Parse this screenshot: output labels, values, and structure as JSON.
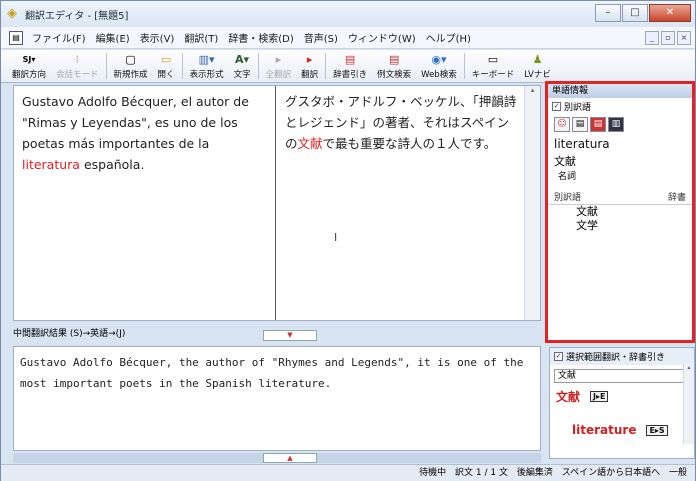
{
  "window": {
    "title": "翻訳エディタ - [無題5]",
    "controls": {
      "minimize": "–",
      "maximize": "□",
      "close": "✕"
    }
  },
  "menu": {
    "items": [
      "ファイル(F)",
      "編集(E)",
      "表示(V)",
      "翻訳(T)",
      "辞書・検索(D)",
      "音声(S)",
      "ウィンドウ(W)",
      "ヘルプ(H)"
    ]
  },
  "toolbar": {
    "buttons": [
      {
        "label": "翻訳方向",
        "icon": "SJ▾",
        "enabled": true
      },
      {
        "label": "会話モード",
        "icon": "⁞",
        "enabled": false
      },
      {
        "label": "新規作成",
        "icon": "▢",
        "enabled": true
      },
      {
        "label": "開く",
        "icon": "▭",
        "enabled": true
      },
      {
        "label": "表示形式",
        "icon": "▥▾",
        "enabled": true
      },
      {
        "label": "文字",
        "icon": "A▾",
        "enabled": true
      },
      {
        "label": "全翻訳",
        "icon": "▸",
        "enabled": false
      },
      {
        "label": "翻訳",
        "icon": "▸",
        "enabled": true
      },
      {
        "label": "辞書引き",
        "icon": "▤",
        "enabled": true
      },
      {
        "label": "例文検索",
        "icon": "▤",
        "enabled": true
      },
      {
        "label": "Web検索",
        "icon": "◉▾",
        "enabled": true
      },
      {
        "label": "キーボード",
        "icon": "▭",
        "enabled": true
      },
      {
        "label": "LVナビ",
        "icon": "♟",
        "enabled": true
      }
    ]
  },
  "editor": {
    "source_pre": "Gustavo Adolfo Bécquer, el autor de \"Rimas y Leyendas\", es uno de los poetas más importantes de la ",
    "source_highlight": "literatura",
    "source_post": " española.",
    "target_pre": "グスタボ・アドルフ・ベッケル、「押韻詩とレジェンド」の著者、それはスペインの",
    "target_highlight": "文献",
    "target_post": "で最も重要な詩人の１人です。"
  },
  "back_translation": {
    "label": "中間翻訳結果 (S)→英語→(J)",
    "text": "Gustavo Adolfo Bécquer, the author of \"Rhymes and Legends\", it is one of the most important poets in the Spanish literature."
  },
  "word_info": {
    "header": "単語情報",
    "alt_words_label": "別訳語",
    "word": "literatura",
    "translation": "文献",
    "pos": "名詞",
    "col_alt": "別訳語",
    "col_dict": "辞書",
    "alternatives": [
      "文献",
      "文学"
    ]
  },
  "selection_lookup": {
    "header": "選択範囲翻訳・辞書引き",
    "query": "文献",
    "entry1": "文献",
    "entry1_badge": "J▸E",
    "entry2": "literature",
    "entry2_badge": "E▸S"
  },
  "status": {
    "state": "待機中",
    "sentence": "訳文 1 / 1 文",
    "edit": "後編集済",
    "direction": "スペイン語から日本語へ",
    "mode": "一般"
  }
}
